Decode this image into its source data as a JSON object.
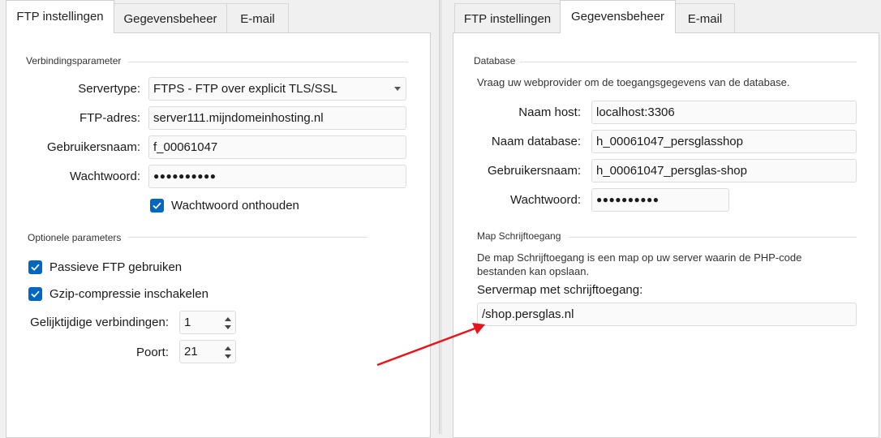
{
  "left": {
    "tabs": [
      "FTP instellingen",
      "Gegevensbeheer",
      "E-mail"
    ],
    "active_tab": 0,
    "connection": {
      "title": "Verbindingsparameter",
      "servertype_label": "Servertype:",
      "servertype_value": "FTPS - FTP over explicit TLS/SSL",
      "ftp_address_label": "FTP-adres:",
      "ftp_address_value": "server111.mijndomeinhosting.nl",
      "username_label": "Gebruikersnaam:",
      "username_value": "f_00061047",
      "password_label": "Wachtwoord:",
      "password_value": "●●●●●●●●●●",
      "remember_label": "Wachtwoord onthouden",
      "remember_checked": true
    },
    "optional": {
      "title": "Optionele parameters",
      "passive_label": "Passieve FTP gebruiken",
      "passive_checked": true,
      "gzip_label": "Gzip-compressie inschakelen",
      "gzip_checked": true,
      "concurrent_label": "Gelijktijdige verbindingen:",
      "concurrent_value": "1",
      "port_label": "Poort:",
      "port_value": "21"
    }
  },
  "right": {
    "tabs": [
      "FTP instellingen",
      "Gegevensbeheer",
      "E-mail"
    ],
    "active_tab": 1,
    "database": {
      "title": "Database",
      "info": "Vraag uw webprovider om de toegangsgegevens van de database.",
      "host_label": "Naam host:",
      "host_value": "localhost:3306",
      "dbname_label": "Naam database:",
      "dbname_value": "h_00061047_persglasshop",
      "username_label": "Gebruikersnaam:",
      "username_value": "h_00061047_persglas-shop",
      "password_label": "Wachtwoord:",
      "password_value": "●●●●●●●●●●"
    },
    "write_access": {
      "title": "Map Schrijftoegang",
      "info": "De map Schrijftoegang is een map op uw server waarin de PHP-code bestanden kan opslaan.",
      "folder_label": "Servermap met schrijftoegang:",
      "folder_value": "/shop.persglas.nl"
    }
  },
  "annotation": {
    "arrow_color": "#e8141b"
  },
  "colors": {
    "accent": "#0067c0",
    "panel_bg": "#ffffff",
    "window_bg": "#f0f0f0"
  }
}
